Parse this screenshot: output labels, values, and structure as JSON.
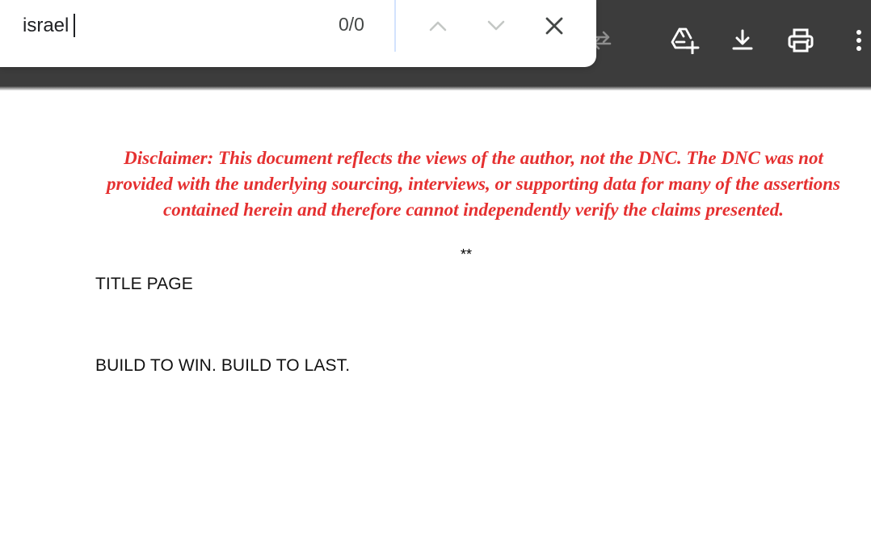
{
  "findbar": {
    "query": "israel",
    "match_count": "0/0",
    "icons": {
      "previous": "chevron-up-icon",
      "next": "chevron-down-icon",
      "close": "close-icon"
    }
  },
  "toolbar": {
    "icons": [
      "rotate-icon",
      "add-to-drive-icon",
      "download-icon",
      "print-icon",
      "more-vert-icon"
    ]
  },
  "document": {
    "disclaimer": "Disclaimer: This document reflects the views of the author, not the DNC. The DNC was not provided with the underlying sourcing, interviews, or supporting data for many of the assertions contained herein and therefore cannot independently verify the claims presented.",
    "separator": "**",
    "lines": [
      "TITLE PAGE",
      "BUILD TO WIN. BUILD TO LAST."
    ]
  },
  "colors": {
    "toolbar_bg": "#3c3c3c",
    "disclaimer_red": "#e53030",
    "divider_blue": "#d3e3fd"
  }
}
